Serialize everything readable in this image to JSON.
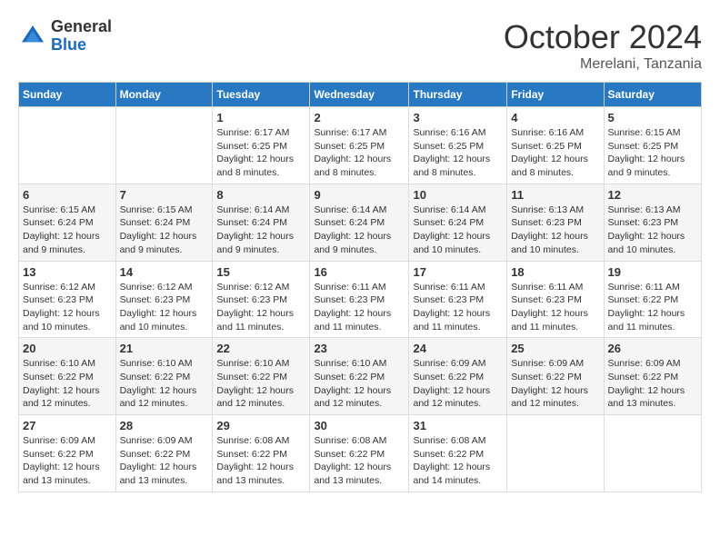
{
  "header": {
    "logo": {
      "general": "General",
      "blue": "Blue"
    },
    "month": "October 2024",
    "location": "Merelani, Tanzania"
  },
  "weekdays": [
    "Sunday",
    "Monday",
    "Tuesday",
    "Wednesday",
    "Thursday",
    "Friday",
    "Saturday"
  ],
  "weeks": [
    [
      {
        "day": "",
        "info": ""
      },
      {
        "day": "",
        "info": ""
      },
      {
        "day": "1",
        "info": "Sunrise: 6:17 AM\nSunset: 6:25 PM\nDaylight: 12 hours and 8 minutes."
      },
      {
        "day": "2",
        "info": "Sunrise: 6:17 AM\nSunset: 6:25 PM\nDaylight: 12 hours and 8 minutes."
      },
      {
        "day": "3",
        "info": "Sunrise: 6:16 AM\nSunset: 6:25 PM\nDaylight: 12 hours and 8 minutes."
      },
      {
        "day": "4",
        "info": "Sunrise: 6:16 AM\nSunset: 6:25 PM\nDaylight: 12 hours and 8 minutes."
      },
      {
        "day": "5",
        "info": "Sunrise: 6:15 AM\nSunset: 6:25 PM\nDaylight: 12 hours and 9 minutes."
      }
    ],
    [
      {
        "day": "6",
        "info": "Sunrise: 6:15 AM\nSunset: 6:24 PM\nDaylight: 12 hours and 9 minutes."
      },
      {
        "day": "7",
        "info": "Sunrise: 6:15 AM\nSunset: 6:24 PM\nDaylight: 12 hours and 9 minutes."
      },
      {
        "day": "8",
        "info": "Sunrise: 6:14 AM\nSunset: 6:24 PM\nDaylight: 12 hours and 9 minutes."
      },
      {
        "day": "9",
        "info": "Sunrise: 6:14 AM\nSunset: 6:24 PM\nDaylight: 12 hours and 9 minutes."
      },
      {
        "day": "10",
        "info": "Sunrise: 6:14 AM\nSunset: 6:24 PM\nDaylight: 12 hours and 10 minutes."
      },
      {
        "day": "11",
        "info": "Sunrise: 6:13 AM\nSunset: 6:23 PM\nDaylight: 12 hours and 10 minutes."
      },
      {
        "day": "12",
        "info": "Sunrise: 6:13 AM\nSunset: 6:23 PM\nDaylight: 12 hours and 10 minutes."
      }
    ],
    [
      {
        "day": "13",
        "info": "Sunrise: 6:12 AM\nSunset: 6:23 PM\nDaylight: 12 hours and 10 minutes."
      },
      {
        "day": "14",
        "info": "Sunrise: 6:12 AM\nSunset: 6:23 PM\nDaylight: 12 hours and 10 minutes."
      },
      {
        "day": "15",
        "info": "Sunrise: 6:12 AM\nSunset: 6:23 PM\nDaylight: 12 hours and 11 minutes."
      },
      {
        "day": "16",
        "info": "Sunrise: 6:11 AM\nSunset: 6:23 PM\nDaylight: 12 hours and 11 minutes."
      },
      {
        "day": "17",
        "info": "Sunrise: 6:11 AM\nSunset: 6:23 PM\nDaylight: 12 hours and 11 minutes."
      },
      {
        "day": "18",
        "info": "Sunrise: 6:11 AM\nSunset: 6:23 PM\nDaylight: 12 hours and 11 minutes."
      },
      {
        "day": "19",
        "info": "Sunrise: 6:11 AM\nSunset: 6:22 PM\nDaylight: 12 hours and 11 minutes."
      }
    ],
    [
      {
        "day": "20",
        "info": "Sunrise: 6:10 AM\nSunset: 6:22 PM\nDaylight: 12 hours and 12 minutes."
      },
      {
        "day": "21",
        "info": "Sunrise: 6:10 AM\nSunset: 6:22 PM\nDaylight: 12 hours and 12 minutes."
      },
      {
        "day": "22",
        "info": "Sunrise: 6:10 AM\nSunset: 6:22 PM\nDaylight: 12 hours and 12 minutes."
      },
      {
        "day": "23",
        "info": "Sunrise: 6:10 AM\nSunset: 6:22 PM\nDaylight: 12 hours and 12 minutes."
      },
      {
        "day": "24",
        "info": "Sunrise: 6:09 AM\nSunset: 6:22 PM\nDaylight: 12 hours and 12 minutes."
      },
      {
        "day": "25",
        "info": "Sunrise: 6:09 AM\nSunset: 6:22 PM\nDaylight: 12 hours and 12 minutes."
      },
      {
        "day": "26",
        "info": "Sunrise: 6:09 AM\nSunset: 6:22 PM\nDaylight: 12 hours and 13 minutes."
      }
    ],
    [
      {
        "day": "27",
        "info": "Sunrise: 6:09 AM\nSunset: 6:22 PM\nDaylight: 12 hours and 13 minutes."
      },
      {
        "day": "28",
        "info": "Sunrise: 6:09 AM\nSunset: 6:22 PM\nDaylight: 12 hours and 13 minutes."
      },
      {
        "day": "29",
        "info": "Sunrise: 6:08 AM\nSunset: 6:22 PM\nDaylight: 12 hours and 13 minutes."
      },
      {
        "day": "30",
        "info": "Sunrise: 6:08 AM\nSunset: 6:22 PM\nDaylight: 12 hours and 13 minutes."
      },
      {
        "day": "31",
        "info": "Sunrise: 6:08 AM\nSunset: 6:22 PM\nDaylight: 12 hours and 14 minutes."
      },
      {
        "day": "",
        "info": ""
      },
      {
        "day": "",
        "info": ""
      }
    ]
  ]
}
